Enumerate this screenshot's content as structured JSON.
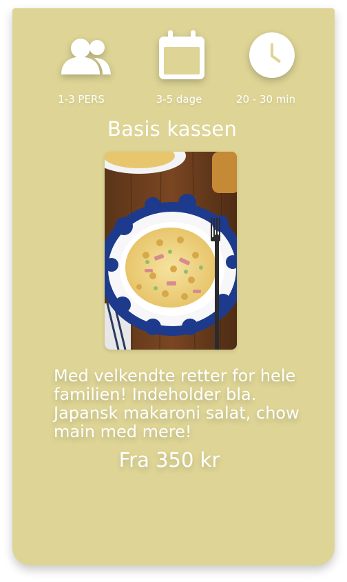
{
  "card": {
    "background_color": "#ddd495",
    "icons": {
      "people": "people-icon",
      "calendar": "calendar-icon",
      "clock": "clock-icon"
    },
    "stats": {
      "persons": "1-3 PERS",
      "days": "3-5 dage",
      "time": "20 - 30 min"
    },
    "title": "Basis kassen",
    "image": "pasta-salad-plate",
    "description": "Med velkendte retter for hele familien! Indeholder bla. Japansk makaroni salat, chow main med mere!",
    "price": "Fra 350 kr"
  }
}
